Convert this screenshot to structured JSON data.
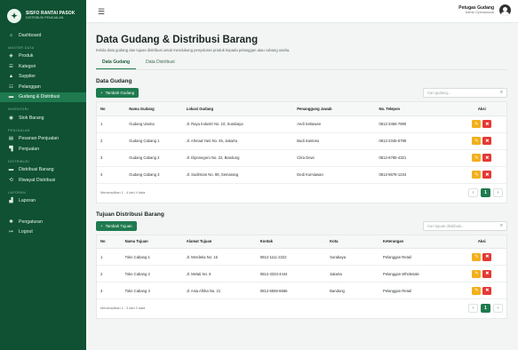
{
  "brand": {
    "title": "SISFO RANTAI PASOK",
    "subtitle": "DISTRIBUSI PENJUALAN"
  },
  "sidebar": {
    "items": [
      {
        "label": "Dashboard",
        "icon": "home-icon",
        "glyph": "⌂"
      },
      {
        "section": "MASTER DATA"
      },
      {
        "label": "Produk",
        "icon": "box-icon",
        "glyph": "◈"
      },
      {
        "label": "Kategori",
        "icon": "tag-icon",
        "glyph": "☰"
      },
      {
        "label": "Supplier",
        "icon": "truck-icon",
        "glyph": "▲"
      },
      {
        "label": "Pelanggan",
        "icon": "users-icon",
        "glyph": "☷"
      },
      {
        "label": "Gudang & Distribusi",
        "icon": "warehouse-icon",
        "glyph": "▬",
        "active": true
      },
      {
        "section": "INVENTORI"
      },
      {
        "label": "Stok Barang",
        "icon": "stock-icon",
        "glyph": "◉"
      },
      {
        "section": "PENJUALAN"
      },
      {
        "label": "Pesanan Penjualan",
        "icon": "order-icon",
        "glyph": "▤"
      },
      {
        "label": "Penjualan",
        "icon": "cart-icon",
        "glyph": "▜"
      },
      {
        "section": "DISTRIBUSI"
      },
      {
        "label": "Distribusi Barang",
        "icon": "distribution-icon",
        "glyph": "▬"
      },
      {
        "label": "Riwayat Distribusi",
        "icon": "history-icon",
        "glyph": "⟲"
      },
      {
        "section": "LAPORAN"
      },
      {
        "label": "Laporan",
        "icon": "chart-icon",
        "glyph": "▟"
      },
      {
        "spacer": true
      },
      {
        "label": "Pengaturan",
        "icon": "gear-icon",
        "glyph": "✺"
      },
      {
        "label": "Logout",
        "icon": "logout-icon",
        "glyph": "↦"
      }
    ]
  },
  "topbar": {
    "user_name": "Petugas Gudang",
    "user_role": "Admin Operasional"
  },
  "page": {
    "title": "Data Gudang & Distribusi Barang",
    "description": "Kelola data gudang dan tujuan distribusi untuk mendukung penyaluran produk kepada pelanggan atau cabang usaha.",
    "tabs": [
      {
        "label": "Data Gudang",
        "active": true
      },
      {
        "label": "Data Distribusi"
      }
    ]
  },
  "gudang": {
    "title": "Data Gudang",
    "add_label": "Tambah Gudang",
    "search_placeholder": "Cari gudang...",
    "columns": [
      "No",
      "Nama Gudang",
      "Lokasi Gudang",
      "Penanggung Jawab",
      "No. Telepon",
      "Aksi"
    ],
    "rows": [
      [
        "1",
        "Gudang Utama",
        "Jl. Raya Industri No. 10, Surabaya",
        "Andi Setiawan",
        "0812-3456-7890"
      ],
      [
        "2",
        "Gudang Cabang 1",
        "Jl. Ahmad Yani No. 45, Jakarta",
        "Budi Santoso",
        "0812-2345-6789"
      ],
      [
        "3",
        "Gudang Cabang 2",
        "Jl. Diponegoro No. 22, Bandung",
        "Citra Dewi",
        "0812-6785-4321"
      ],
      [
        "4",
        "Gudang Cabang 3",
        "Jl. Sudirman No. 88, Semarang",
        "Dedi Kurniawan",
        "0812-5678-1234"
      ]
    ],
    "footer": "Menampilkan 1 - 4 dari 4 data",
    "page": "1"
  },
  "tujuan": {
    "title": "Tujuan Distribusi Barang",
    "add_label": "Tambah Tujuan",
    "search_placeholder": "Cari tujuan distribusi...",
    "columns": [
      "No",
      "Nama Tujuan",
      "Alamat Tujuan",
      "Kontak",
      "Kota",
      "Keterangan",
      "Aksi"
    ],
    "rows": [
      [
        "1",
        "Toko Cabang 1",
        "Jl. Merdeka No. 15",
        "0812-1111-2222",
        "Surabaya",
        "Pelanggan Retail"
      ],
      [
        "2",
        "Toko Cabang 2",
        "Jl. Melati No. 8",
        "0812-3333-4444",
        "Jakarta",
        "Pelanggan Wholesale"
      ],
      [
        "3",
        "Toko Cabang 3",
        "Jl. Asia Afrika No. 21",
        "0812-5555-6666",
        "Bandung",
        "Pelanggan Retail"
      ]
    ],
    "footer": "Menampilkan 1 - 3 dari 3 data",
    "page": "1"
  },
  "colors": {
    "sidebar": "#0f5132",
    "accent": "#1f7a4f",
    "edit": "#f2b01e",
    "delete": "#e53935"
  }
}
